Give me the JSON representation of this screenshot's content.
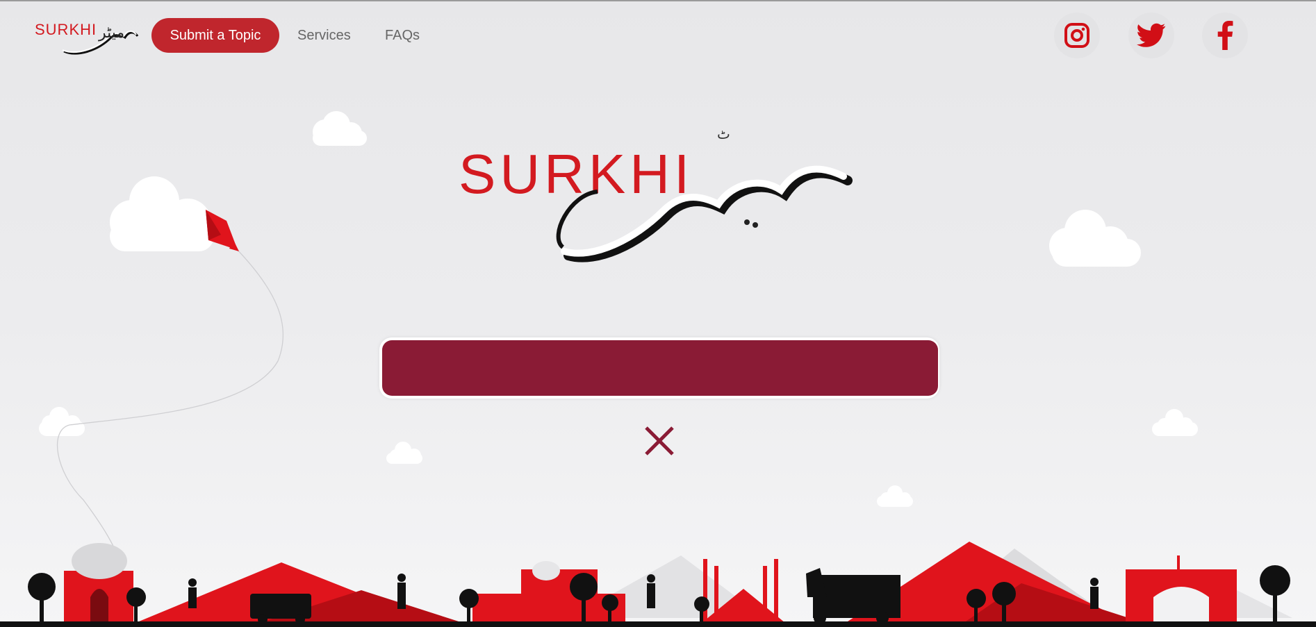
{
  "brand": {
    "latin": "SURKHI",
    "urdu": "میٹر"
  },
  "nav": {
    "submit_label": "Submit a Topic",
    "services_label": "Services",
    "faqs_label": "FAQs"
  },
  "social": [
    {
      "name": "instagram-icon"
    },
    {
      "name": "twitter-icon"
    },
    {
      "name": "facebook-icon"
    }
  ],
  "search": {
    "value": "",
    "placeholder": ""
  },
  "colors": {
    "accent": "#c0262d",
    "search_bg": "#8a1b35",
    "close_x": "#8a1b35",
    "skyline_red": "#e0141c"
  }
}
